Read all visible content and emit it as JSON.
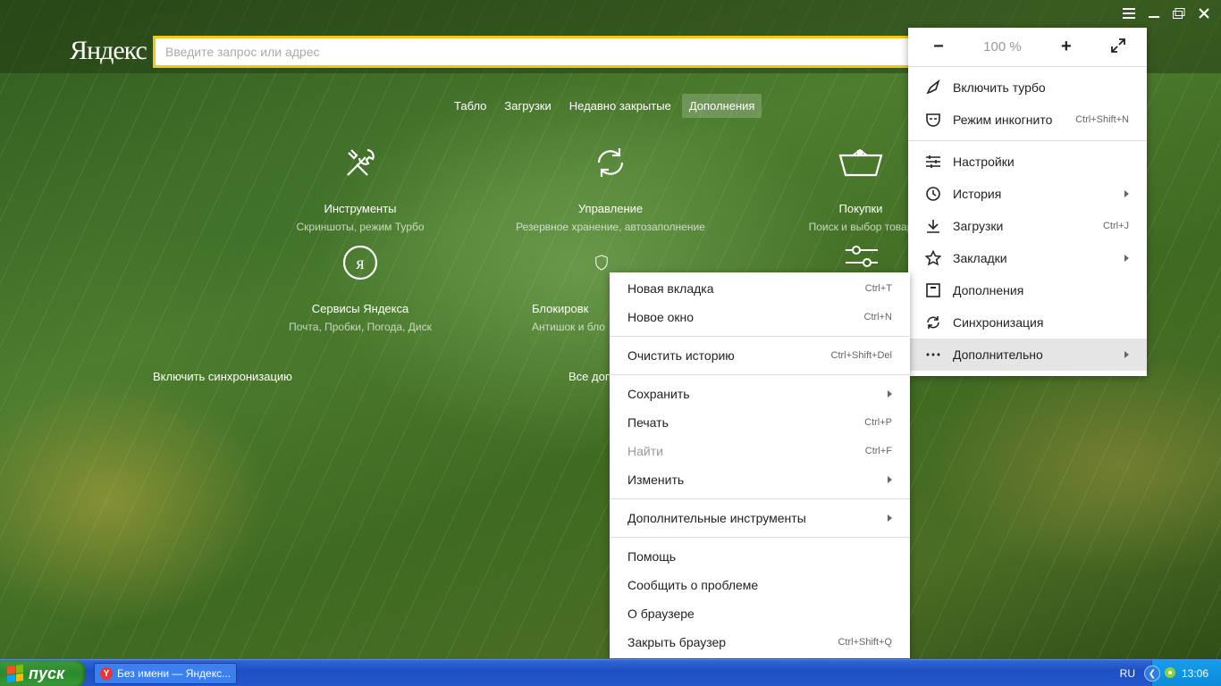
{
  "window": {
    "title": "Без имени — Яндекс..."
  },
  "header": {
    "logo": "Яндекс",
    "search_placeholder": "Введите запрос или адрес"
  },
  "tabs": [
    {
      "label": "Табло"
    },
    {
      "label": "Загрузки"
    },
    {
      "label": "Недавно закрытые"
    },
    {
      "label": "Дополнения",
      "active": true
    }
  ],
  "tiles": {
    "tools": {
      "title": "Инструменты",
      "sub": "Скриншоты, режим Турбо",
      "icon": "tools-icon"
    },
    "manage": {
      "title": "Управление",
      "sub": "Резервное хранение, автозаполнение",
      "icon": "sync-icon"
    },
    "shopping": {
      "title": "Покупки",
      "sub": "Поиск и выбор товар",
      "icon": "basket-icon"
    },
    "yandex": {
      "title": "Сервисы Яндекса",
      "sub": "Почта, Пробки, Погода, Диск",
      "icon": "yandex-icon"
    },
    "blocking": {
      "title": "Блокировк",
      "sub": "Антишок и бло",
      "icon": "shield-icon"
    },
    "settings_icon": "sliders-icon"
  },
  "links": {
    "sync": "Включить синхронизацию",
    "all_addons": "Все доп"
  },
  "main_menu": {
    "zoom": {
      "value": "100 %",
      "minus": "−",
      "plus": "+"
    },
    "items": [
      {
        "label": "Включить турбо",
        "shortcut": "",
        "icon": "rocket-icon"
      },
      {
        "label": "Режим инкогнито",
        "shortcut": "Ctrl+Shift+N",
        "icon": "incognito-icon"
      },
      {
        "label": "Настройки",
        "shortcut": "",
        "icon": "settings-icon"
      },
      {
        "label": "История",
        "shortcut": "",
        "icon": "clock-icon"
      },
      {
        "label": "Загрузки",
        "shortcut": "Ctrl+J",
        "icon": "download-icon"
      },
      {
        "label": "Закладки",
        "shortcut": "",
        "icon": "star-icon"
      },
      {
        "label": "Дополнения",
        "shortcut": "",
        "icon": "addons-icon"
      },
      {
        "label": "Синхронизация",
        "shortcut": "",
        "icon": "sync-icon"
      },
      {
        "label": "Дополнительно",
        "shortcut": "",
        "icon": "more-icon"
      }
    ]
  },
  "submenu": {
    "items": [
      {
        "label": "Новая вкладка",
        "shortcut": "Ctrl+T"
      },
      {
        "label": "Новое окно",
        "shortcut": "Ctrl+N"
      },
      {
        "label": "Очистить историю",
        "shortcut": "Ctrl+Shift+Del"
      },
      {
        "label": "Сохранить",
        "shortcut": ""
      },
      {
        "label": "Печать",
        "shortcut": "Ctrl+P"
      },
      {
        "label": "Найти",
        "shortcut": "Ctrl+F"
      },
      {
        "label": "Изменить",
        "shortcut": ""
      },
      {
        "label": "Дополнительные инструменты",
        "shortcut": ""
      },
      {
        "label": "Помощь",
        "shortcut": ""
      },
      {
        "label": "Сообщить о проблеме",
        "shortcut": ""
      },
      {
        "label": "О браузере",
        "shortcut": ""
      },
      {
        "label": "Закрыть браузер",
        "shortcut": "Ctrl+Shift+Q"
      }
    ]
  },
  "taskbar": {
    "start": "пуск",
    "task": "Без имени — Яндекс...",
    "lang": "RU",
    "clock": "13:06"
  }
}
